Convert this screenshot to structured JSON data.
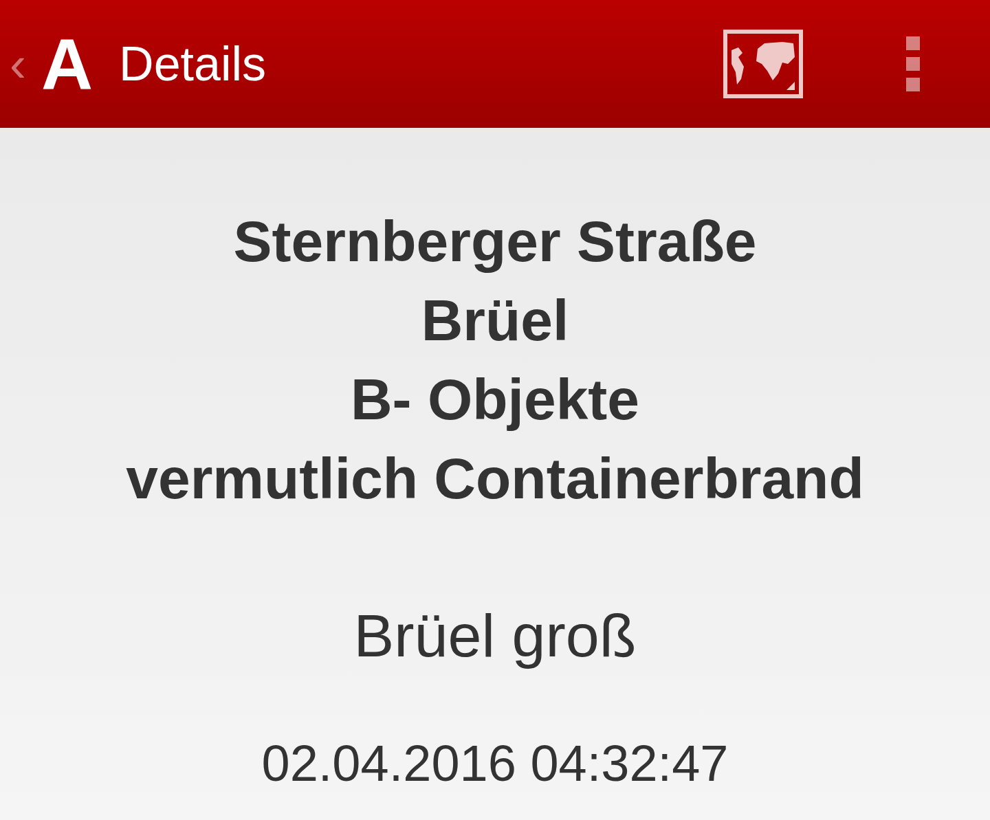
{
  "app_bar": {
    "back": "‹",
    "logo": "A",
    "title": "Details"
  },
  "incident": {
    "lines": [
      "Sternberger Straße",
      "Brüel",
      "B- Objekte",
      "vermutlich Containerbrand"
    ],
    "unit": "Brüel groß",
    "timestamp": "02.04.2016 04:32:47"
  }
}
